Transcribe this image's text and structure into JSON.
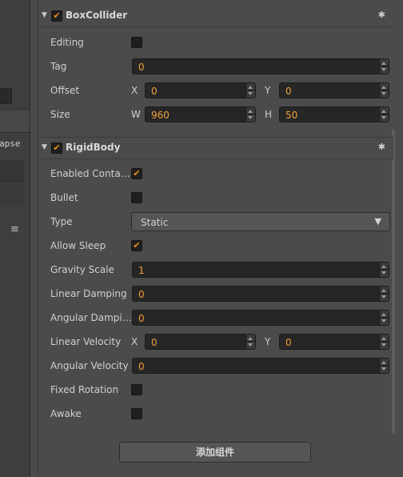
{
  "left_pane": {
    "collapse_text": "apse",
    "menu_icon": "hamburger-icon"
  },
  "box_collider": {
    "title": "BoxCollider",
    "enabled": true,
    "editing_label": "Editing",
    "editing": false,
    "tag_label": "Tag",
    "tag_value": "0",
    "offset_label": "Offset",
    "offset_x_axis": "X",
    "offset_x": "0",
    "offset_y_axis": "Y",
    "offset_y": "0",
    "size_label": "Size",
    "size_w_axis": "W",
    "size_w": "960",
    "size_h_axis": "H",
    "size_h": "50"
  },
  "rigid_body": {
    "title": "RigidBody",
    "enabled": true,
    "enabled_contact_label": "Enabled Conta…",
    "enabled_contact": true,
    "bullet_label": "Bullet",
    "bullet": false,
    "type_label": "Type",
    "type_value": "Static",
    "allow_sleep_label": "Allow Sleep",
    "allow_sleep": true,
    "gravity_scale_label": "Gravity Scale",
    "gravity_scale": "1",
    "linear_damping_label": "Linear Damping",
    "linear_damping": "0",
    "angular_damping_label": "Angular Dampi…",
    "angular_damping": "0",
    "linear_velocity_label": "Linear Velocity",
    "linear_velocity_x_axis": "X",
    "linear_velocity_x": "0",
    "linear_velocity_y_axis": "Y",
    "linear_velocity_y": "0",
    "angular_velocity_label": "Angular Velocity",
    "angular_velocity": "0",
    "fixed_rotation_label": "Fixed Rotation",
    "fixed_rotation": false,
    "awake_label": "Awake",
    "awake": false
  },
  "add_component_label": "添加组件",
  "colors": {
    "accent": "#f08c1a",
    "value_text": "#f0a03c",
    "panel_bg": "#4b4b4b",
    "field_bg": "#262626"
  }
}
